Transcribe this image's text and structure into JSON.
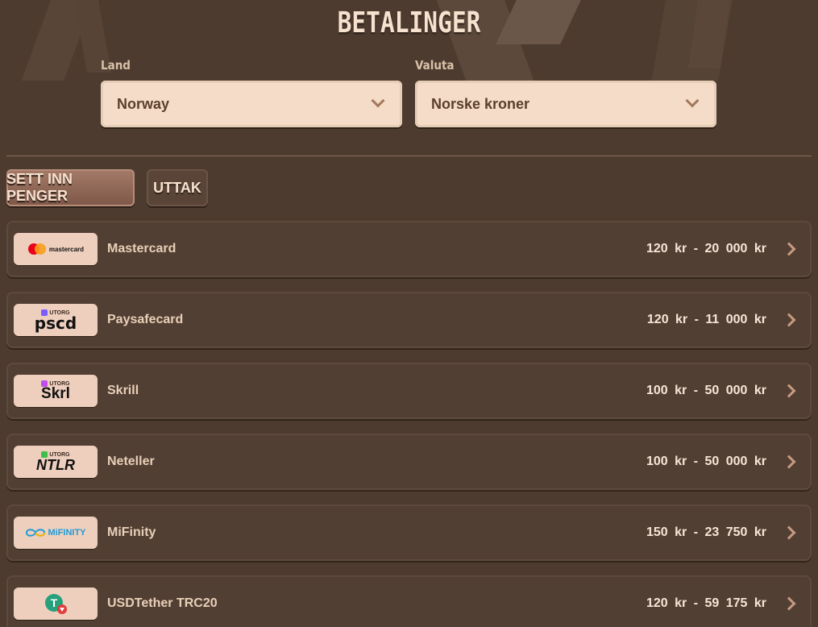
{
  "header": {
    "title": "BETALINGER"
  },
  "filters": {
    "country_label": "Land",
    "country_value": "Norway",
    "currency_label": "Valuta",
    "currency_value": "Norske kroner"
  },
  "tabs": [
    {
      "label": "SETT INN PENGER",
      "active": true
    },
    {
      "label": "UTTAK",
      "active": false
    }
  ],
  "methods": [
    {
      "name": "Mastercard",
      "range": "120 kr - 20 000 kr",
      "logo": "mastercard-logo",
      "logo_text": "mastercard"
    },
    {
      "name": "Paysafecard",
      "range": "120 kr - 11 000 kr",
      "logo": "paysafecard-logo",
      "logo_text": "pscd",
      "badge": "UTORG"
    },
    {
      "name": "Skrill",
      "range": "100 kr - 50 000 kr",
      "logo": "skrill-logo",
      "logo_text": "Skrl",
      "badge": "UTORG"
    },
    {
      "name": "Neteller",
      "range": "100 kr - 50 000 kr",
      "logo": "neteller-logo",
      "logo_text": "NTLR",
      "badge": "UTORG"
    },
    {
      "name": "MiFinity",
      "range": "150 kr - 23 750 kr",
      "logo": "mifinity-logo",
      "logo_text": "MiFINITY"
    },
    {
      "name": "USDTether TRC20",
      "range": "120 kr - 59 175 kr",
      "logo": "tether-logo",
      "logo_text": "T"
    }
  ],
  "colors": {
    "background": "#4d3b30",
    "accent": "#a57a68",
    "field_bg": "#f4dcc8"
  }
}
